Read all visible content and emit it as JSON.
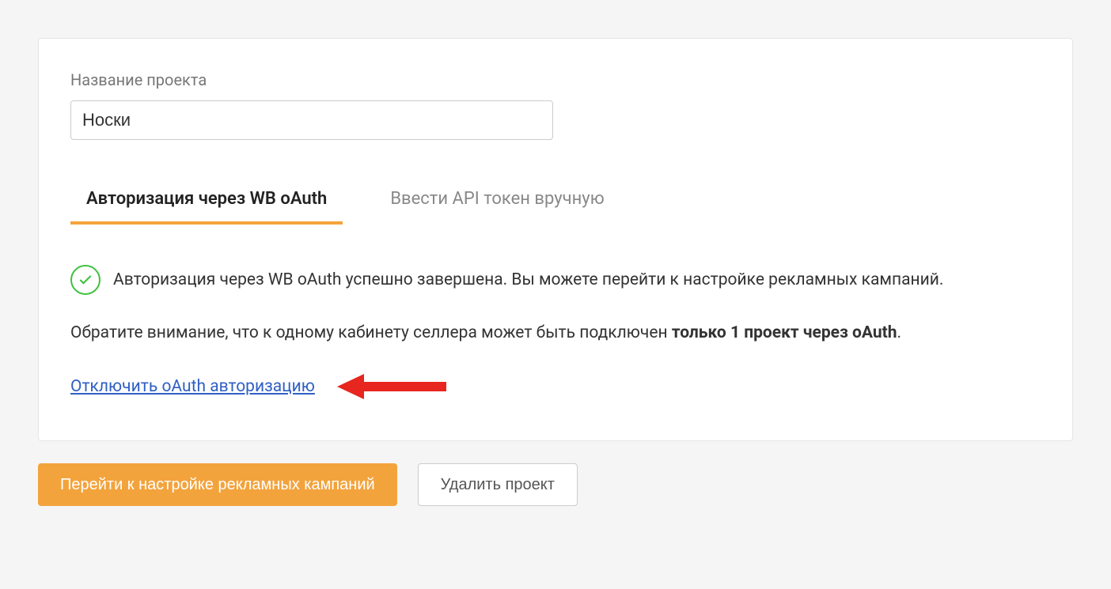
{
  "project": {
    "label": "Название проекта",
    "value": "Носки"
  },
  "tabs": {
    "oauth": "Авторизация через WB oAuth",
    "token": "Ввести API токен вручную"
  },
  "status": {
    "message": "Авторизация через WB oAuth успешно завершена. Вы можете перейти к настройке рекламных кампаний."
  },
  "notice": {
    "prefix": "Обратите внимание, что к одному кабинету селлера может быть подключен ",
    "bold": "только 1 проект через oAuth",
    "suffix": "."
  },
  "links": {
    "disconnect": "Отключить oAuth авторизацию"
  },
  "buttons": {
    "campaigns": "Перейти к настройке рекламных кампаний",
    "delete": "Удалить проект"
  }
}
